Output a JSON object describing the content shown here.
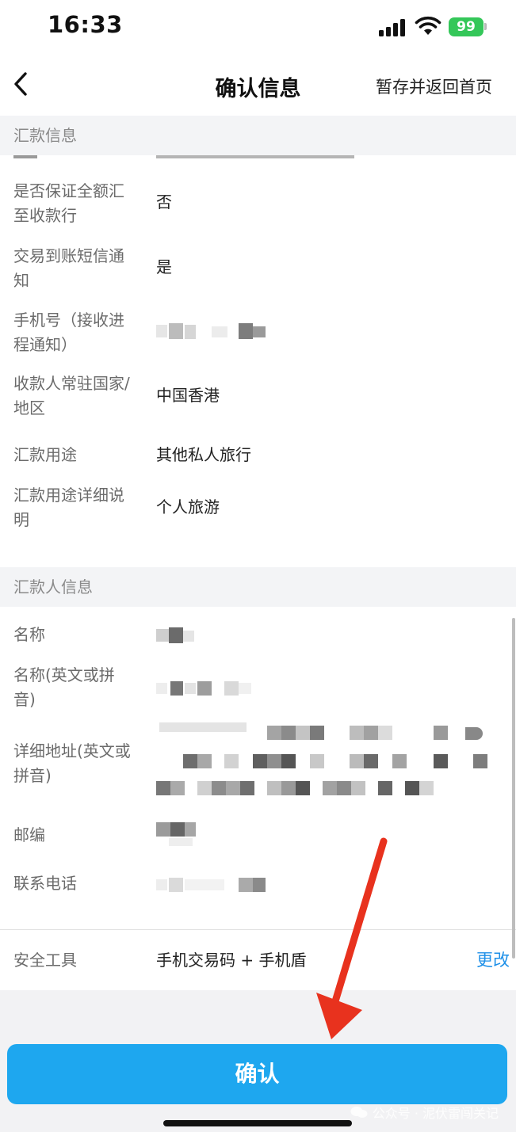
{
  "status_bar": {
    "time": "16:33",
    "battery": "99"
  },
  "nav": {
    "title": "确认信息",
    "right_action": "暂存并返回首页"
  },
  "remit_section": {
    "header": "汇款信息",
    "rows": [
      {
        "label": "是否保证全额汇至收款行",
        "value": "否"
      },
      {
        "label": "交易到账短信通知",
        "value": "是"
      },
      {
        "label": "手机号（接收进程通知）",
        "value": ""
      },
      {
        "label": "收款人常驻国家/地区",
        "value": "中国香港"
      },
      {
        "label": "汇款用途",
        "value": "其他私人旅行"
      },
      {
        "label": "汇款用途详细说明",
        "value": "个人旅游"
      }
    ]
  },
  "remitter_section": {
    "header": "汇款人信息",
    "rows": [
      {
        "label": "名称"
      },
      {
        "label": "名称(英文或拼音)"
      },
      {
        "label": "详细地址(英文或拼音)"
      },
      {
        "label": "邮编"
      },
      {
        "label": "联系电话"
      }
    ]
  },
  "security": {
    "label": "安全工具",
    "value": "手机交易码 + 手机盾",
    "change": "更改"
  },
  "confirm_label": "确认",
  "watermark": "公众号 · 泥伏雷闯关记",
  "colors": {
    "accent": "#1ea7ef",
    "link": "#1e90e8",
    "arrow": "#e8321e"
  }
}
